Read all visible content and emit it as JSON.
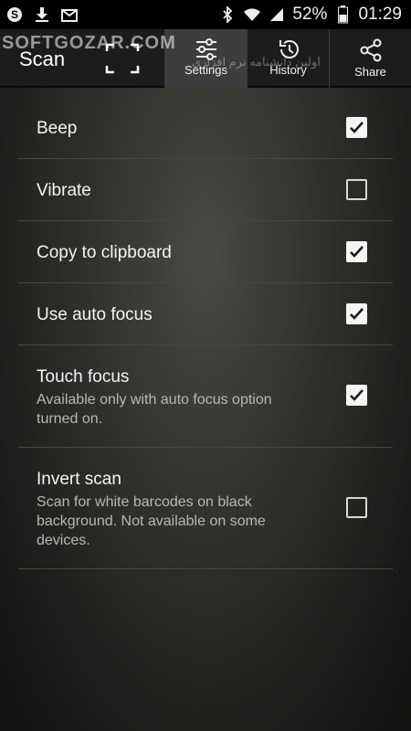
{
  "status_bar": {
    "battery": "52%",
    "time": "01:29",
    "icons": [
      "skype-icon",
      "download-icon",
      "mail-icon",
      "bluetooth-icon",
      "wifi-icon",
      "signal-icon",
      "battery-icon"
    ]
  },
  "action_bar": {
    "title": "Scan",
    "tabs": [
      {
        "label": "Settings",
        "icon": "sliders-icon",
        "active": true
      },
      {
        "label": "History",
        "icon": "history-icon",
        "active": false
      },
      {
        "label": "Share",
        "icon": "share-icon",
        "active": false
      }
    ]
  },
  "watermark": {
    "text": "SOFTGOZAR.COM",
    "subtext": "اولین دانشنامه نرم افزاری"
  },
  "settings": [
    {
      "title": "Beep",
      "summary": "",
      "checked": true
    },
    {
      "title": "Vibrate",
      "summary": "",
      "checked": false
    },
    {
      "title": "Copy to clipboard",
      "summary": "",
      "checked": true
    },
    {
      "title": "Use auto focus",
      "summary": "",
      "checked": true
    },
    {
      "title": "Touch focus",
      "summary": "Available only with auto focus option turned on.",
      "checked": true
    },
    {
      "title": "Invert scan",
      "summary": "Scan for white barcodes on black background. Not available on some devices.",
      "checked": false
    }
  ]
}
